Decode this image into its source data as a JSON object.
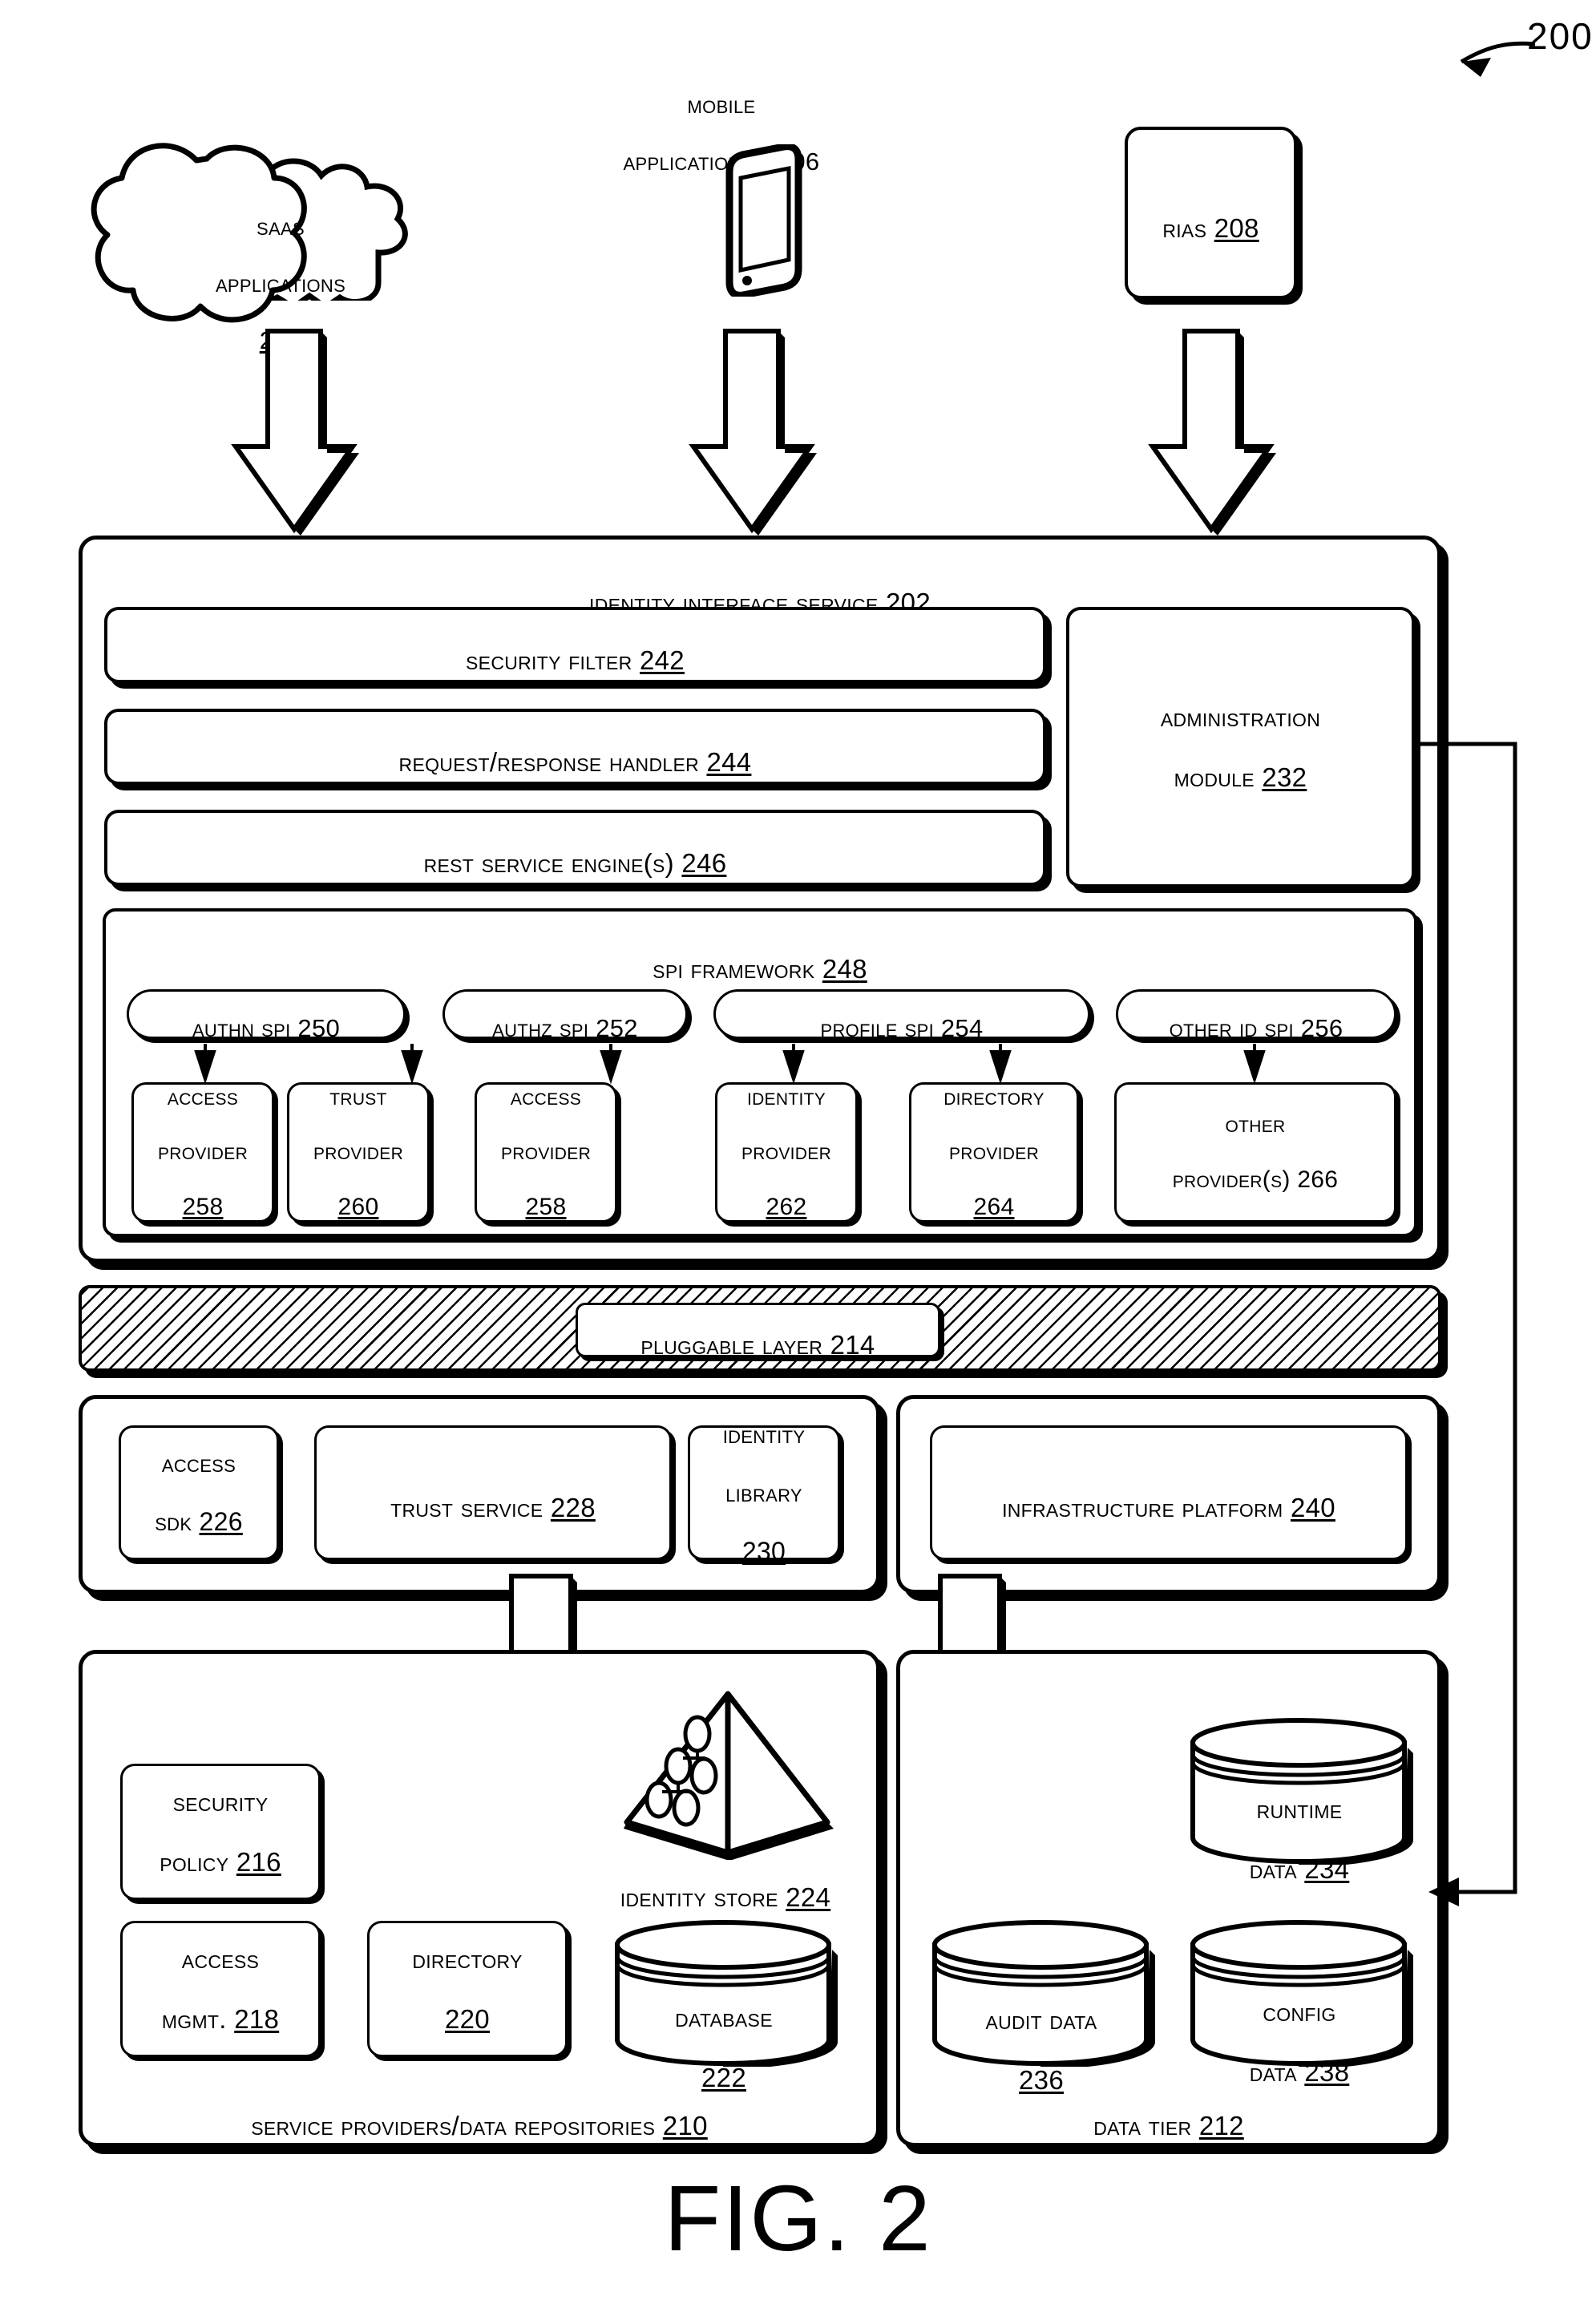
{
  "figure": {
    "caption": "FIG. 2",
    "system_ref": "200"
  },
  "clients": {
    "saas": {
      "line1": "SaaS",
      "line2": "Applications",
      "ref": "204"
    },
    "mobile": {
      "line1": "Mobile",
      "line2": "Application(s) 206",
      "ref": "206",
      "icon": "mobile-phone-icon"
    },
    "rias": {
      "label": "RIAs ",
      "ref": "208"
    }
  },
  "identity_interface_service": {
    "title": "Identity Interface Service ",
    "ref": "202",
    "security_filter": {
      "label": "Security Filter ",
      "ref": "242"
    },
    "request_response_handler": {
      "label": "Request/Response Handler ",
      "ref": "244"
    },
    "rest_service_engine": {
      "label": "REST Service Engine(s) ",
      "ref": "246"
    },
    "administration_module": {
      "line1": "Administration",
      "line2": "Module ",
      "ref": "232"
    },
    "spi_framework": {
      "title": "SPI Framework ",
      "ref": "248",
      "spis": [
        {
          "label": "AuthN SPI ",
          "ref": "250"
        },
        {
          "label": "AuthZ SPI ",
          "ref": "252"
        },
        {
          "label": "Profile SPI ",
          "ref": "254"
        },
        {
          "label": "Other ID SPI ",
          "ref": "256"
        }
      ],
      "providers": [
        {
          "line1": "Access",
          "line2": "Provider",
          "ref": "258"
        },
        {
          "line1": "Trust",
          "line2": "Provider",
          "ref": "260"
        },
        {
          "line1": "Access",
          "line2": "Provider",
          "ref": "258"
        },
        {
          "line1": "Identity",
          "line2": "Provider",
          "ref": "262"
        },
        {
          "line1": "Directory",
          "line2": "Provider",
          "ref": "264"
        },
        {
          "line1": "Other",
          "line2": "Provider(s) 266",
          "ref": "266"
        }
      ]
    }
  },
  "pluggable_layer": {
    "label": "Pluggable Layer ",
    "ref": "214"
  },
  "middle_left_panel": {
    "access_sdk": {
      "line1": "Access",
      "line2": "SDK ",
      "ref": "226"
    },
    "trust_service": {
      "label": "Trust Service ",
      "ref": "228"
    },
    "identity_library": {
      "line1": "Identity",
      "line2": "Library",
      "ref": "230"
    }
  },
  "middle_right_panel": {
    "infrastructure_platform": {
      "label": "Infrastructure Platform ",
      "ref": "240"
    }
  },
  "service_providers_panel": {
    "title": "Service Providers/Data Repositories ",
    "ref": "210",
    "security_policy": {
      "line1": "Security",
      "line2": "Policy ",
      "ref": "216"
    },
    "access_mgmt": {
      "line1": "Access",
      "line2": "Mgmt. ",
      "ref": "218"
    },
    "directory": {
      "line1": "Directory",
      "ref": "220"
    },
    "database": {
      "line1": "Database",
      "ref": "222"
    },
    "identity_store": {
      "label": "Identity Store ",
      "ref": "224",
      "icon": "pyramid-icon"
    }
  },
  "data_tier_panel": {
    "title": "Data Tier ",
    "ref": "212",
    "runtime_data": {
      "line1": "Runtime",
      "line2": "Data ",
      "ref": "234"
    },
    "audit_data": {
      "line1": "Audit Data",
      "ref": "236"
    },
    "config_data": {
      "line1": "Config",
      "line2": "Data ",
      "ref": "238"
    }
  }
}
